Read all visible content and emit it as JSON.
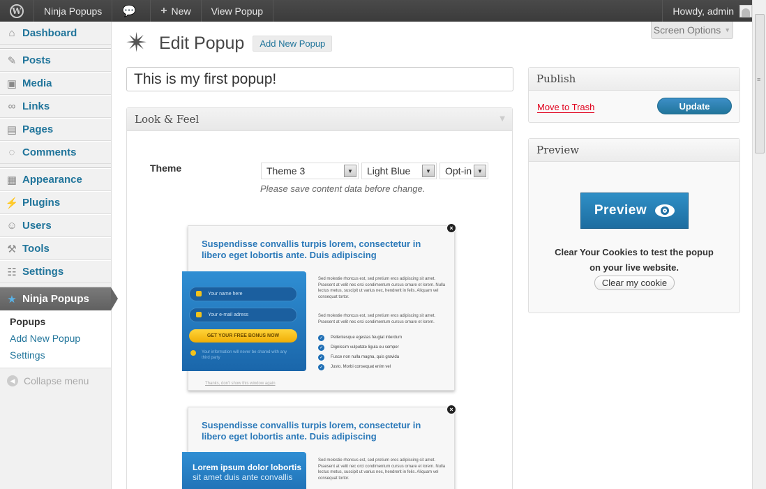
{
  "adminbar": {
    "site_name": "Ninja Popups",
    "new_label": "New",
    "view_label": "View Popup",
    "howdy": "Howdy, admin"
  },
  "sidebar": {
    "items": [
      {
        "label": "Dashboard",
        "icon": "dashboard-icon"
      },
      {
        "label": "Posts",
        "icon": "pin-icon"
      },
      {
        "label": "Media",
        "icon": "media-icon"
      },
      {
        "label": "Links",
        "icon": "link-icon"
      },
      {
        "label": "Pages",
        "icon": "pages-icon"
      },
      {
        "label": "Comments",
        "icon": "comment-icon"
      },
      {
        "label": "Appearance",
        "icon": "appearance-icon"
      },
      {
        "label": "Plugins",
        "icon": "plug-icon"
      },
      {
        "label": "Users",
        "icon": "users-icon"
      },
      {
        "label": "Tools",
        "icon": "tools-icon"
      },
      {
        "label": "Settings",
        "icon": "settings-icon"
      },
      {
        "label": "Ninja Popups",
        "icon": "star-icon"
      }
    ],
    "submenu": [
      "Popups",
      "Add New Popup",
      "Settings"
    ],
    "collapse": "Collapse menu"
  },
  "screen_options": "Screen Options",
  "page": {
    "title": "Edit Popup",
    "add_new": "Add New Popup",
    "popup_title_value": "This is my first popup!"
  },
  "look_feel": {
    "heading": "Look & Feel",
    "theme_label": "Theme",
    "theme_select": "Theme 3",
    "color_select": "Light Blue",
    "type_select": "Opt-in",
    "notice": "Please save content data before change."
  },
  "popup1": {
    "heading": "Suspendisse convallis turpis lorem, consectetur in libero eget lobortis ante. Duis adipiscing",
    "name_field": "Your name here",
    "email_field": "Your e-mail adress",
    "bonus_btn": "GET YOUR FREE BONUS NOW",
    "privacy": "Your information will never be shared with any third party",
    "para1": "Sed molestie rhoncus est, sed pretium eros adipiscing sit amet. Praesent at velit nec orci condimentum cursus ornare et lorem. Nulla lectus metus, suscipit ut varius nec, hendrerit in felis. Aliquam vel consequat tortor.",
    "para2": "Sed molestie rhoncus est, sed pretium eros adipiscing sit amet. Praesent at velit nec orci condimentum cursus ornare et lorem.",
    "checks": [
      "Pellentesque egestas feugiat interdum",
      "Dignissim vulputate ligula eu semper",
      "Fusce non nulla magna, quis gravida",
      "Justo. Morbi consequat enim vel"
    ],
    "footer": "Thanks, don't show this window again"
  },
  "popup2": {
    "heading": "Suspendisse convallis turpis lorem, consectetur in libero eget lobortis ante. Duis adipiscing",
    "lorem_bold": "Lorem ipsum dolor lobortis",
    "lorem_sub": "sit amet duis ante convallis",
    "para1": "Sed molestie rhoncus est, sed pretium eros adipiscing sit amet. Praesent at velit nec orci condimentum cursus ornare et lorem. Nulla lectus metus, suscipit ut varius nec, hendrerit in felis. Aliquam vel consequat tortor."
  },
  "publish": {
    "heading": "Publish",
    "trash": "Move to Trash",
    "update": "Update"
  },
  "preview": {
    "heading": "Preview",
    "button": "Preview",
    "cookie_line1": "Clear Your Cookies to test the popup",
    "cookie_line2": "on your live website.",
    "clear_btn": "Clear my cookie"
  },
  "colors": {
    "link": "#21759b",
    "admin_bar": "#464646",
    "accent_blue": "#2b79b9",
    "trash_red": "#e0001c"
  }
}
